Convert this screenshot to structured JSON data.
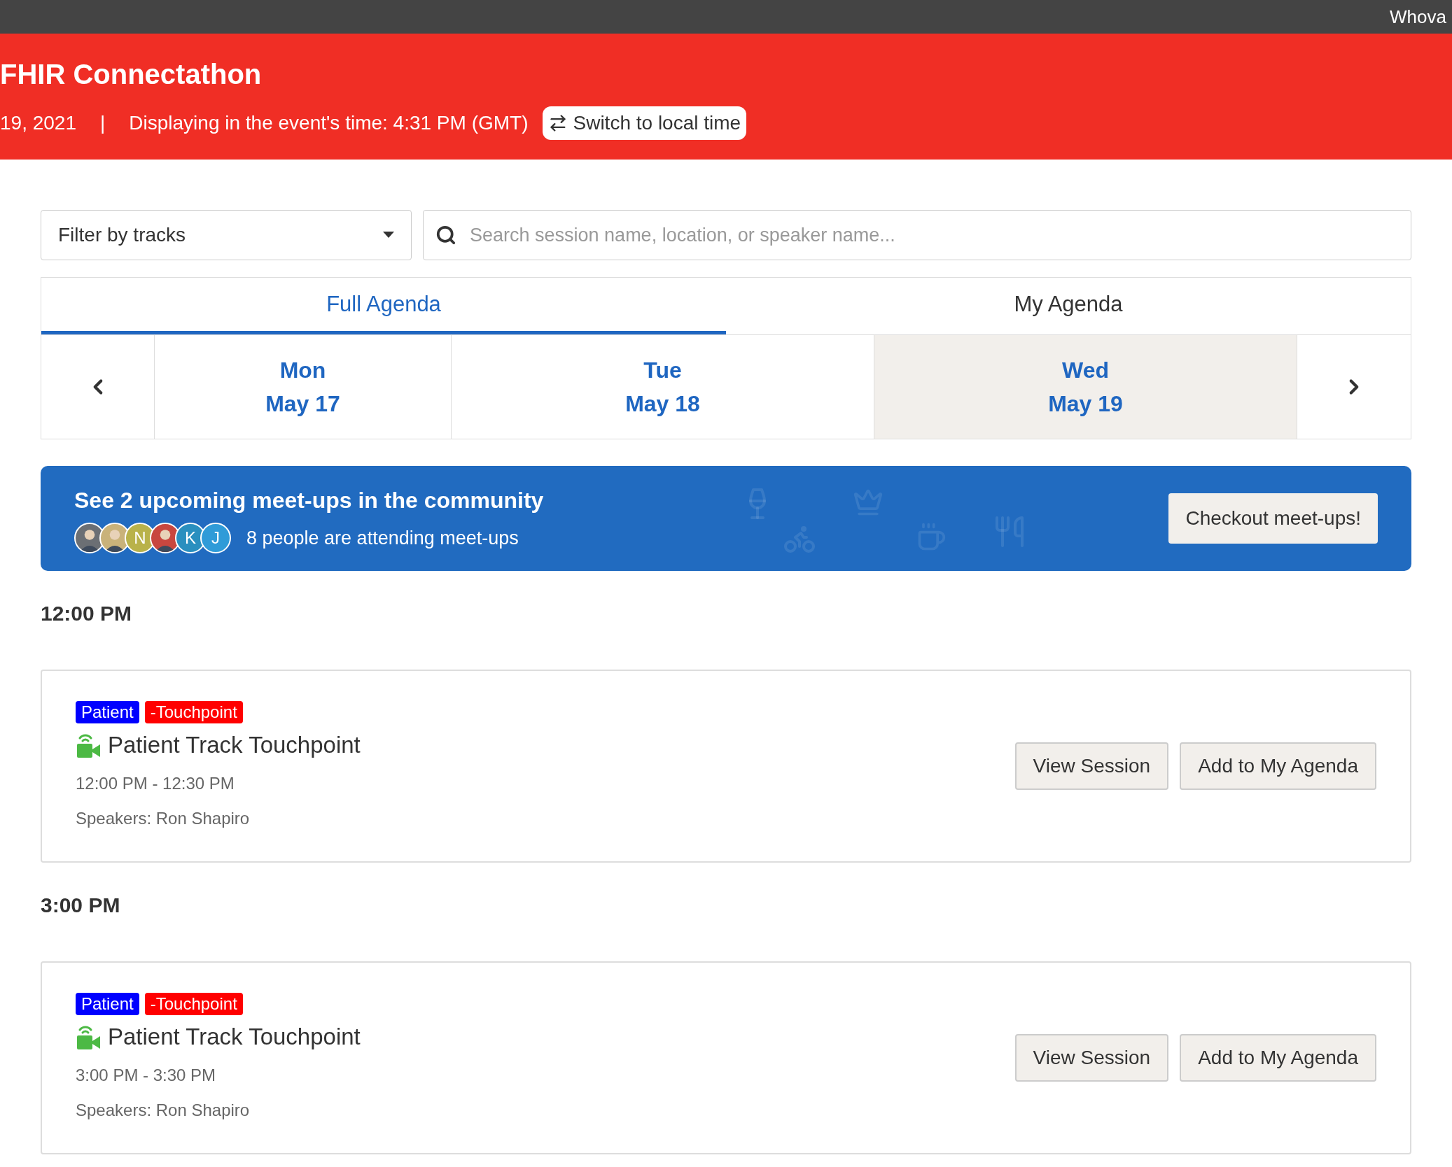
{
  "top_bar": {
    "brand": "Whova"
  },
  "header": {
    "title": "FHIR Connectathon",
    "date": "19, 2021",
    "separator": "|",
    "time_note": "Displaying in the event's time: 4:31 PM (GMT)",
    "switch_button": "Switch to local time"
  },
  "filter": {
    "value": "Filter by tracks"
  },
  "search": {
    "placeholder": "Search session name, location, or speaker name..."
  },
  "tabs": [
    {
      "label": "Full Agenda",
      "selected": true
    },
    {
      "label": "My Agenda",
      "selected": false
    }
  ],
  "days": [
    {
      "weekday": "Mon",
      "date": "May 17",
      "selected": false
    },
    {
      "weekday": "Tue",
      "date": "May 18",
      "selected": false
    },
    {
      "weekday": "Wed",
      "date": "May 19",
      "selected": true
    }
  ],
  "meetups": {
    "title": "See 2 upcoming meet-ups in the community",
    "attending": "8 people are attending meet-ups",
    "button": "Checkout meet-ups!",
    "avatars": [
      {
        "kind": "photo",
        "color": "#6b6f74"
      },
      {
        "kind": "photo",
        "color": "#c9b27a"
      },
      {
        "kind": "letter",
        "letter": "N",
        "color": "#b9b24a"
      },
      {
        "kind": "photo",
        "color": "#c8473f"
      },
      {
        "kind": "letter",
        "letter": "K",
        "color": "#2a8fbf"
      },
      {
        "kind": "letter",
        "letter": "J",
        "color": "#2f9bd8"
      }
    ]
  },
  "slots": [
    {
      "time": "12:00 PM",
      "sessions": [
        {
          "tags": [
            {
              "label": "Patient",
              "color": "#0000ff"
            },
            {
              "label": "-Touchpoint",
              "color": "#ff0000"
            }
          ],
          "title": "Patient Track Touchpoint",
          "hours": "12:00 PM - 12:30 PM",
          "speakers": "Speakers: Ron Shapiro",
          "buttons": [
            "View Session",
            "Add to My Agenda"
          ]
        }
      ]
    },
    {
      "time": "3:00 PM",
      "sessions": [
        {
          "tags": [
            {
              "label": "Patient",
              "color": "#0000ff"
            },
            {
              "label": "-Touchpoint",
              "color": "#ff0000"
            }
          ],
          "title": "Patient Track Touchpoint",
          "hours": "3:00 PM - 3:30 PM",
          "speakers": "Speakers: Ron Shapiro",
          "buttons": [
            "View Session",
            "Add to My Agenda"
          ]
        }
      ]
    }
  ]
}
